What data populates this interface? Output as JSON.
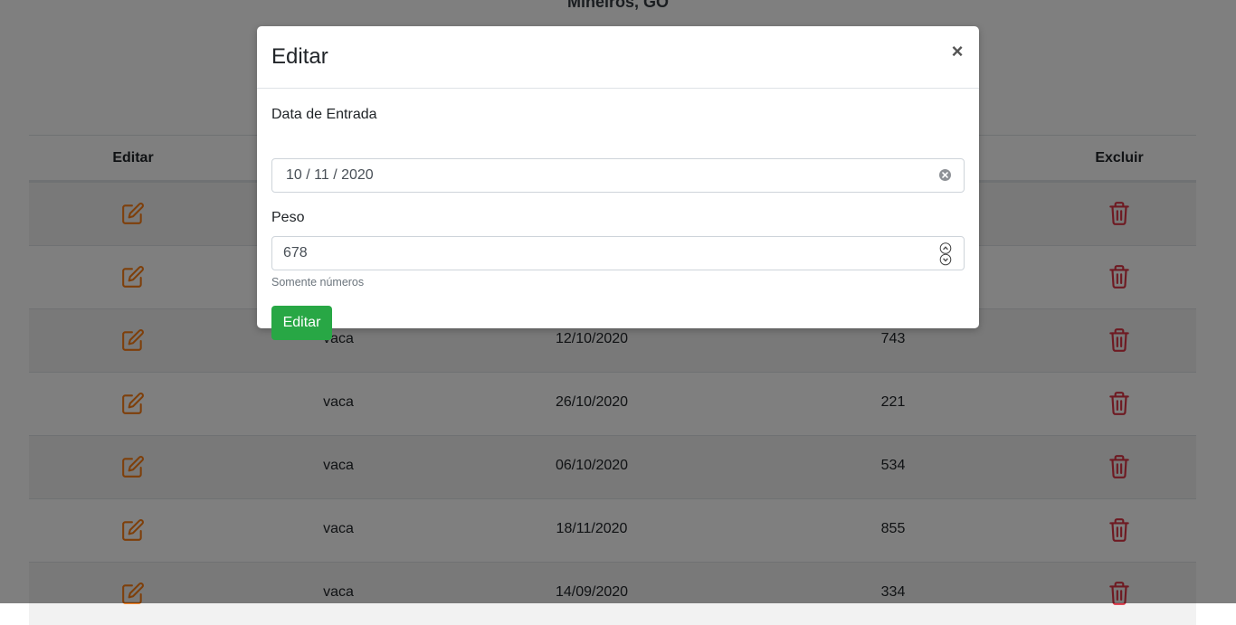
{
  "page": {
    "subtitle": "Mineiros, GO"
  },
  "table": {
    "headers": {
      "edit": "Editar",
      "delete": "Excluir"
    },
    "rows": [
      {
        "type": "",
        "date": "",
        "weight": ""
      },
      {
        "type": "",
        "date": "",
        "weight": ""
      },
      {
        "type": "vaca",
        "date": "12/10/2020",
        "weight": "743"
      },
      {
        "type": "vaca",
        "date": "26/10/2020",
        "weight": "221"
      },
      {
        "type": "vaca",
        "date": "06/10/2020",
        "weight": "534"
      },
      {
        "type": "vaca",
        "date": "18/11/2020",
        "weight": "855"
      },
      {
        "type": "vaca",
        "date": "14/09/2020",
        "weight": "334"
      }
    ]
  },
  "modal": {
    "title": "Editar",
    "close_label": "×",
    "date_label": "Data de Entrada",
    "date_value": "10 / 11 / 2020",
    "weight_label": "Peso",
    "weight_value": "678",
    "weight_help": "Somente números",
    "submit_label": "Editar"
  },
  "colors": {
    "edit_icon": "#fd7e14",
    "delete_icon": "#dc3545",
    "submit_button": "#28a745"
  },
  "icons": {
    "edit": "edit-icon",
    "delete": "trash-icon",
    "close": "close-icon",
    "clear": "clear-icon",
    "spinner": "spinner-icon"
  }
}
